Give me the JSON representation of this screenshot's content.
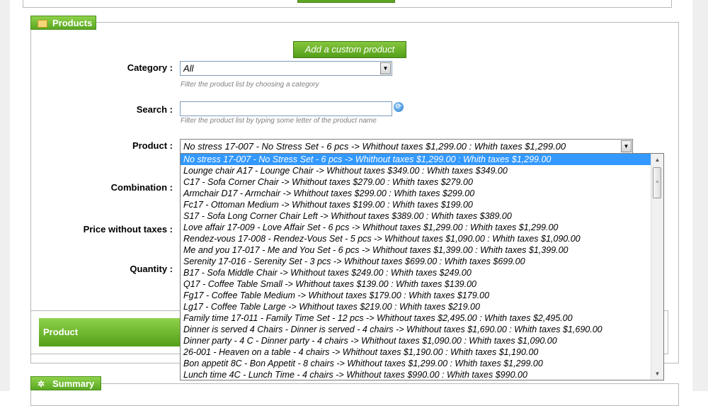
{
  "products_section": {
    "legend": "Products",
    "add_button": "Add a custom product",
    "category_label": "Category :",
    "category_value": "All",
    "category_hint": "Filter the product list by choosing a category",
    "search_label": "Search :",
    "search_value": "",
    "search_hint": "Filter the product list by typing some letter of the product name",
    "product_label": "Product :",
    "product_value": "No stress 17-007 - No Stress Set - 6 pcs -> Whithout taxes $1,299.00 : Whith taxes $1,299.00",
    "combination_label": "Combination :",
    "price_label": "Price without taxes :",
    "quantity_label": "Quantity :",
    "product_bar_label": "Product"
  },
  "summary_section": {
    "legend": "Summary"
  },
  "dropdown": {
    "selected_index": 0,
    "options": [
      "No stress 17-007 - No Stress Set - 6 pcs -> Whithout taxes $1,299.00 : Whith taxes $1,299.00",
      "Lounge chair A17 - Lounge Chair -> Whithout taxes $349.00 : Whith taxes $349.00",
      "C17 - Sofa Corner Chair -> Whithout taxes $279.00 : Whith taxes $279.00",
      "Armchair D17 - Armchair -> Whithout taxes $299.00 : Whith taxes $299.00",
      "Fc17 - Ottoman Medium -> Whithout taxes $199.00 : Whith taxes $199.00",
      "S17 - Sofa Long Corner Chair Left -> Whithout taxes $389.00 : Whith taxes $389.00",
      "Love affair 17-009 - Love Affair Set - 6 pcs -> Whithout taxes $1,299.00 : Whith taxes $1,299.00",
      "Rendez-vous 17-008 - Rendez-Vous Set - 5 pcs -> Whithout taxes $1,090.00 : Whith taxes $1,090.00",
      "Me and you 17-017 - Me and You Set - 6 pcs -> Whithout taxes $1,399.00 : Whith taxes $1,399.00",
      "Serenity 17-016 - Serenity Set - 3 pcs -> Whithout taxes $699.00 : Whith taxes $699.00",
      "B17 - Sofa Middle Chair -> Whithout taxes $249.00 : Whith taxes $249.00",
      "Q17 - Coffee Table Small -> Whithout taxes $139.00 : Whith taxes $139.00",
      "Fg17 - Coffee Table Medium -> Whithout taxes $179.00 : Whith taxes $179.00",
      "Lg17 - Coffee Table Large -> Whithout taxes $219.00 : Whith taxes $219.00",
      "Family time 17-011 - Family Time Set - 12 pcs -> Whithout taxes $2,495.00 : Whith taxes $2,495.00",
      "Dinner is served 4 Chairs - Dinner is served - 4 chairs -> Whithout taxes $1,690.00 : Whith taxes $1,690.00",
      "Dinner party - 4 C - Dinner party - 4 chairs -> Whithout taxes $1,090.00 : Whith taxes $1,090.00",
      "26-001 - Heaven on a table - 4 chairs -> Whithout taxes $1,190.00 : Whith taxes $1,190.00",
      "Bon appetit 8C - Bon Appetit - 8 chairs -> Whithout taxes $1,299.00 : Whith taxes $1,299.00",
      "Lunch time 4C - Lunch Time - 4 chairs -> Whithout taxes $990.00 : Whith taxes $990.00"
    ]
  },
  "icons": {
    "products_legend": "folder-icon",
    "summary_legend": "summary-icon",
    "search_refresh": "refresh-icon",
    "dropdown_arrow": "chevron-down-icon"
  },
  "colors": {
    "accent_green": "#5aa722",
    "selection_blue": "#3399ff"
  }
}
